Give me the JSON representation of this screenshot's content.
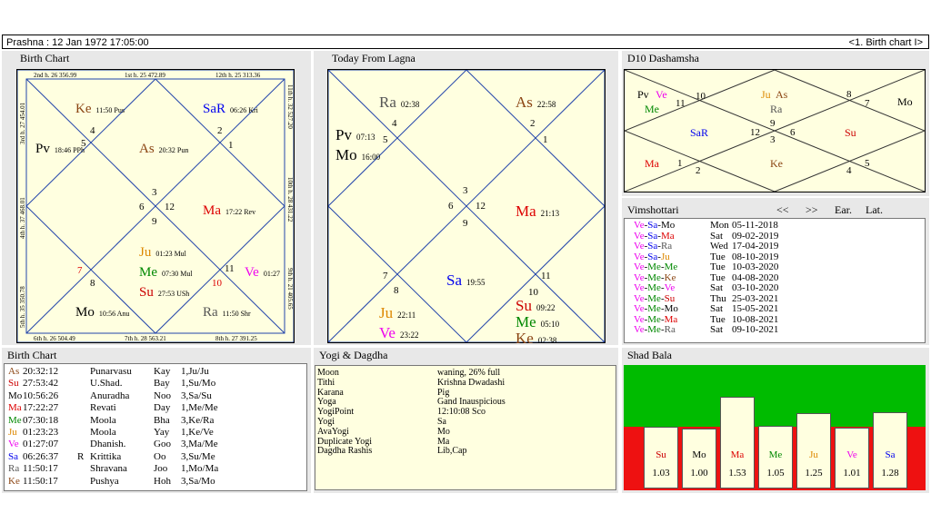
{
  "topbar": {
    "left": "Prashna :   12 Jan 1972  17:05:00",
    "right": "<1. Birth chart I>"
  },
  "birth_chart": {
    "title": "Birth Chart",
    "border_labels": {
      "top": [
        "2nd h. 26 356.99",
        "1st h. 25 472.89",
        "12th h. 25 313.36"
      ],
      "bottom": [
        "6th h. 26 504.49",
        "7th h. 28 563.21",
        "8th h. 27 391.25"
      ],
      "left": [
        "3rd h. 27 454.01",
        "4th h. 37 468.01",
        "5th h. 35 350.78"
      ],
      "right": [
        "11th h. 32 527.20",
        "10th h. 28 431.22",
        "9th h. 21 405.65"
      ]
    },
    "signs": [
      "4",
      "5",
      "2",
      "1",
      "3",
      "6",
      "12",
      "9",
      "7",
      "8",
      "11",
      "10"
    ],
    "planets": [
      {
        "name": "Ke",
        "detail": "11:50 Pus",
        "color": "#8b4513"
      },
      {
        "name": "SaR",
        "detail": "06:26 Kri",
        "color": "#0000ee"
      },
      {
        "name": "Pv",
        "detail": "18:46 PPh",
        "color": "#000000"
      },
      {
        "name": "As",
        "detail": "20:32 Pun",
        "color": "#8b4513"
      },
      {
        "name": "Ma",
        "detail": "17:22 Rev",
        "color": "#dd0000"
      },
      {
        "name": "Ju",
        "detail": "01:23 Mul",
        "color": "#dd8800"
      },
      {
        "name": "Me",
        "detail": "07:30 Mul",
        "color": "#008800"
      },
      {
        "name": "Su",
        "detail": "27:53 USh",
        "color": "#cc0000"
      },
      {
        "name": "Ve",
        "detail": "01:27",
        "color": "#ee00ee"
      },
      {
        "name": "Mo",
        "detail": "10:56 Anu",
        "color": "#000000"
      },
      {
        "name": "Ra",
        "detail": "11:50 Shr",
        "color": "#555555"
      }
    ]
  },
  "today_lagna": {
    "title": "Today From Lagna",
    "signs": [
      "4",
      "5",
      "2",
      "1",
      "3",
      "6",
      "12",
      "9",
      "8",
      "7",
      "11",
      "10"
    ],
    "planets": [
      {
        "name": "Ra",
        "detail": "02:38",
        "color": "#555555"
      },
      {
        "name": "As",
        "detail": "22:58",
        "color": "#8b4513"
      },
      {
        "name": "Pv",
        "detail": "07:13",
        "color": "#000000"
      },
      {
        "name": "Mo",
        "detail": "16:00",
        "color": "#000000"
      },
      {
        "name": "Ma",
        "detail": "21:13",
        "color": "#dd0000"
      },
      {
        "name": "Sa",
        "detail": "19:55",
        "color": "#0000ee"
      },
      {
        "name": "Ju",
        "detail": "22:11",
        "color": "#dd8800"
      },
      {
        "name": "Ve",
        "detail": "23:22",
        "color": "#ee00ee"
      },
      {
        "name": "Su",
        "detail": "09:22",
        "color": "#cc0000"
      },
      {
        "name": "Me",
        "detail": "05:10",
        "color": "#008800"
      },
      {
        "name": "Ke",
        "detail": "02:38",
        "color": "#8b4513"
      }
    ]
  },
  "d10": {
    "title": "D10 Dashamsha",
    "signs": [
      "10",
      "11",
      "8",
      "7",
      "12",
      "9",
      "3",
      "6",
      "1",
      "2",
      "4",
      "5"
    ],
    "planets": [
      {
        "name": "Pv",
        "color": "#000000"
      },
      {
        "name": "Ve",
        "color": "#ee00ee"
      },
      {
        "name": "Me",
        "color": "#008800"
      },
      {
        "name": "Ju",
        "color": "#dd8800"
      },
      {
        "name": "As",
        "color": "#8b4513"
      },
      {
        "name": "Ra",
        "color": "#555555"
      },
      {
        "name": "Mo",
        "color": "#000000"
      },
      {
        "name": "SaR",
        "color": "#0000ee"
      },
      {
        "name": "Su",
        "color": "#cc0000"
      },
      {
        "name": "Ma",
        "color": "#dd0000"
      },
      {
        "name": "Ke",
        "color": "#8b4513"
      }
    ]
  },
  "vimshottari": {
    "title": "Vimshottari",
    "nav": {
      "prev": "<<",
      "next": ">>",
      "ear": "Ear.",
      "lat": "Lat."
    },
    "rows": [
      {
        "p": [
          [
            "Ve",
            "#ee00ee"
          ],
          [
            "Sa",
            "#0000ee"
          ],
          [
            "Mo",
            "#000000"
          ]
        ],
        "day": "Mon",
        "date": "05-11-2018"
      },
      {
        "p": [
          [
            "Ve",
            "#ee00ee"
          ],
          [
            "Sa",
            "#0000ee"
          ],
          [
            "Ma",
            "#dd0000"
          ]
        ],
        "day": "Sat",
        "date": "09-02-2019"
      },
      {
        "p": [
          [
            "Ve",
            "#ee00ee"
          ],
          [
            "Sa",
            "#0000ee"
          ],
          [
            "Ra",
            "#555555"
          ]
        ],
        "day": "Wed",
        "date": "17-04-2019"
      },
      {
        "p": [
          [
            "Ve",
            "#ee00ee"
          ],
          [
            "Sa",
            "#0000ee"
          ],
          [
            "Ju",
            "#dd8800"
          ]
        ],
        "day": "Tue",
        "date": "08-10-2019"
      },
      {
        "p": [
          [
            "Ve",
            "#ee00ee"
          ],
          [
            "Me",
            "#008800"
          ],
          [
            "Me",
            "#008800"
          ]
        ],
        "day": "Tue",
        "date": "10-03-2020"
      },
      {
        "p": [
          [
            "Ve",
            "#ee00ee"
          ],
          [
            "Me",
            "#008800"
          ],
          [
            "Ke",
            "#8b4513"
          ]
        ],
        "day": "Tue",
        "date": "04-08-2020"
      },
      {
        "p": [
          [
            "Ve",
            "#ee00ee"
          ],
          [
            "Me",
            "#008800"
          ],
          [
            "Ve",
            "#ee00ee"
          ]
        ],
        "day": "Sat",
        "date": "03-10-2020"
      },
      {
        "p": [
          [
            "Ve",
            "#ee00ee"
          ],
          [
            "Me",
            "#008800"
          ],
          [
            "Su",
            "#cc0000"
          ]
        ],
        "day": "Thu",
        "date": "25-03-2021"
      },
      {
        "p": [
          [
            "Ve",
            "#ee00ee"
          ],
          [
            "Me",
            "#008800"
          ],
          [
            "Mo",
            "#000000"
          ]
        ],
        "day": "Sat",
        "date": "15-05-2021"
      },
      {
        "p": [
          [
            "Ve",
            "#ee00ee"
          ],
          [
            "Me",
            "#008800"
          ],
          [
            "Ma",
            "#dd0000"
          ]
        ],
        "day": "Tue",
        "date": "10-08-2021"
      },
      {
        "p": [
          [
            "Ve",
            "#ee00ee"
          ],
          [
            "Me",
            "#008800"
          ],
          [
            "Ra",
            "#555555"
          ]
        ],
        "day": "Sat",
        "date": "09-10-2021"
      }
    ]
  },
  "birth_table": {
    "title": "Birth Chart",
    "rows": [
      {
        "planet": "As",
        "color": "#8b4513",
        "deg": "20:32:12",
        "r": "",
        "nak": "Punarvasu",
        "pada": "Kay",
        "lord": "1,Ju/Ju"
      },
      {
        "planet": "Su",
        "color": "#cc0000",
        "deg": "27:53:42",
        "r": "",
        "nak": "U.Shad.",
        "pada": "Bay",
        "lord": "1,Su/Mo"
      },
      {
        "planet": "Mo",
        "color": "#000000",
        "deg": "10:56:26",
        "r": "",
        "nak": "Anuradha",
        "pada": "Noo",
        "lord": "3,Sa/Su"
      },
      {
        "planet": "Ma",
        "color": "#dd0000",
        "deg": "17:22:27",
        "r": "",
        "nak": "Revati",
        "pada": "Day",
        "lord": "1,Me/Me"
      },
      {
        "planet": "Me",
        "color": "#008800",
        "deg": "07:30:18",
        "r": "",
        "nak": "Moola",
        "pada": "Bha",
        "lord": "3,Ke/Ra"
      },
      {
        "planet": "Ju",
        "color": "#dd8800",
        "deg": "01:23:23",
        "r": "",
        "nak": "Moola",
        "pada": "Yay",
        "lord": "1,Ke/Ve"
      },
      {
        "planet": "Ve",
        "color": "#ee00ee",
        "deg": "01:27:07",
        "r": "",
        "nak": "Dhanish.",
        "pada": "Goo",
        "lord": "3,Ma/Me"
      },
      {
        "planet": "Sa",
        "color": "#0000ee",
        "deg": "06:26:37",
        "r": "R",
        "nak": "Krittika",
        "pada": "Oo",
        "lord": "3,Su/Me"
      },
      {
        "planet": "Ra",
        "color": "#555555",
        "deg": "11:50:17",
        "r": "",
        "nak": "Shravana",
        "pada": "Joo",
        "lord": "1,Mo/Ma"
      },
      {
        "planet": "Ke",
        "color": "#8b4513",
        "deg": "11:50:17",
        "r": "",
        "nak": "Pushya",
        "pada": "Hoh",
        "lord": "3,Sa/Mo"
      }
    ]
  },
  "yogi": {
    "title": "Yogi & Dagdha",
    "rows": [
      {
        "k": "Moon",
        "v": "waning, 26% full"
      },
      {
        "k": "Tithi",
        "v": "Krishna  Dwadashi"
      },
      {
        "k": "Karana",
        "v": "Pig"
      },
      {
        "k": "Yoga",
        "v": "Gand Inauspicious"
      },
      {
        "k": "YogiPoint",
        "v": "12:10:08 Sco"
      },
      {
        "k": "Yogi",
        "v": "Sa"
      },
      {
        "k": "AvaYogi",
        "v": "Mo"
      },
      {
        "k": "Duplicate Yogi",
        "v": "Ma"
      },
      {
        "k": "Dagdha Rashis",
        "v": "Lib,Cap"
      }
    ]
  },
  "shad_bala": {
    "title": "Shad Bala",
    "colors": {
      "above": "#00bb00",
      "below": "#ee1111"
    },
    "bars": [
      {
        "name": "Su",
        "value": "1.03",
        "num": 1.03,
        "color": "#cc0000"
      },
      {
        "name": "Mo",
        "value": "1.00",
        "num": 1.0,
        "color": "#000000"
      },
      {
        "name": "Ma",
        "value": "1.53",
        "num": 1.53,
        "color": "#dd0000"
      },
      {
        "name": "Me",
        "value": "1.05",
        "num": 1.05,
        "color": "#008800"
      },
      {
        "name": "Ju",
        "value": "1.25",
        "num": 1.25,
        "color": "#dd8800"
      },
      {
        "name": "Ve",
        "value": "1.01",
        "num": 1.01,
        "color": "#ee00ee"
      },
      {
        "name": "Sa",
        "value": "1.28",
        "num": 1.28,
        "color": "#0000ee"
      }
    ]
  }
}
